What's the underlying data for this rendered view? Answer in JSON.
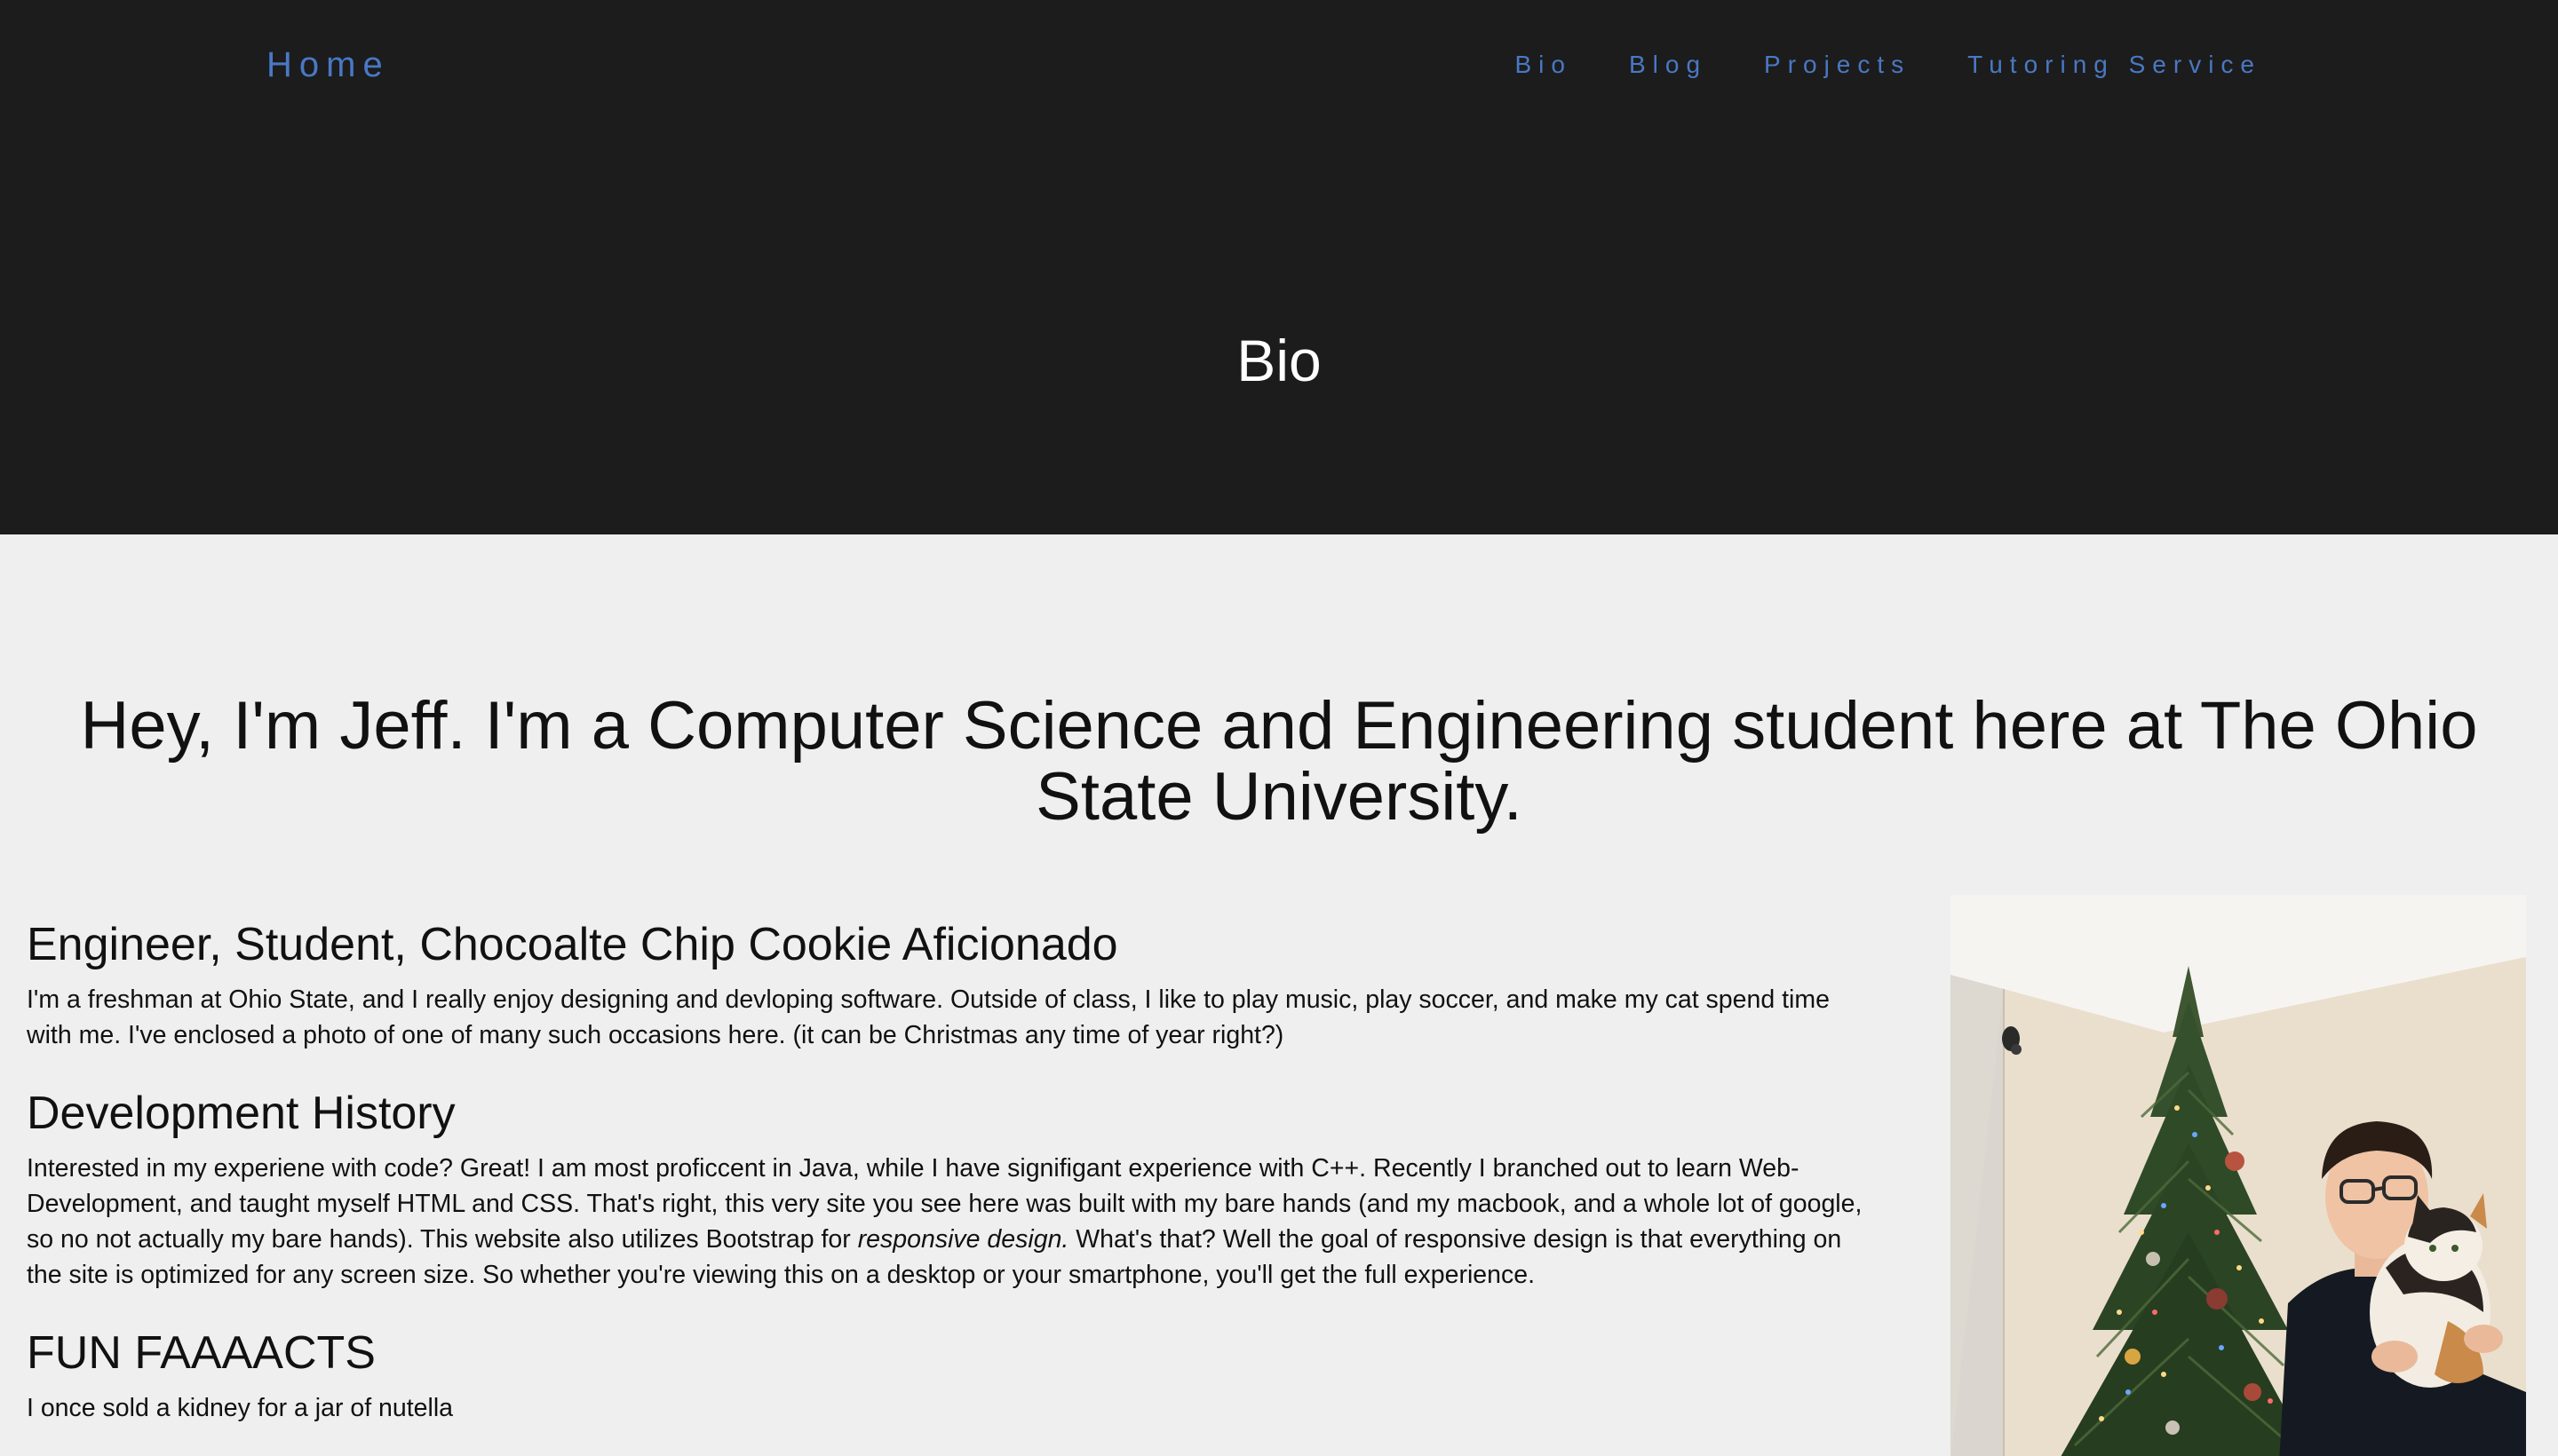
{
  "nav": {
    "home_label": "Home",
    "links": [
      {
        "label": "Bio"
      },
      {
        "label": "Blog"
      },
      {
        "label": "Projects"
      },
      {
        "label": "Tutoring Service"
      }
    ]
  },
  "hero": {
    "title": "Bio"
  },
  "intro": {
    "heading": "Hey, I'm Jeff. I'm a Computer Science and Engineering student here at The Ohio State University."
  },
  "sections": [
    {
      "heading": "Engineer, Student, Chocoalte Chip Cookie Aficionado",
      "body": "I'm a freshman at Ohio State, and I really enjoy designing and devloping software. Outside of class, I like to play music, play soccer, and make my cat spend time with me. I've enclosed a photo of one of many such occasions here. (it can be Christmas any time of year right?)"
    },
    {
      "heading": "Development History",
      "body_before": "Interested in my experiene with code? Great! I am most proficcent in Java, while I have signifigant experience with C++. Recently I branched out to learn Web-Development, and taught myself HTML and CSS. That's right, this very site you see here was built with my bare hands (and my macbook, and a whole lot of google, so no not actually my bare hands). This website also utilizes Bootstrap for ",
      "body_emphasis": "responsive design.",
      "body_after": " What's that? Well the goal of responsive design is that everything on the site is optimized for any screen size. So whether you're viewing this on a desktop or your smartphone, you'll get the full experience."
    },
    {
      "heading": "FUN FAAAACTS",
      "body": "I once sold a kidney for a jar of nutella"
    }
  ],
  "colors": {
    "header_bg": "#1c1c1c",
    "page_bg": "#efefef",
    "nav_link": "#4a78c4",
    "hero_title": "#ffffff"
  }
}
